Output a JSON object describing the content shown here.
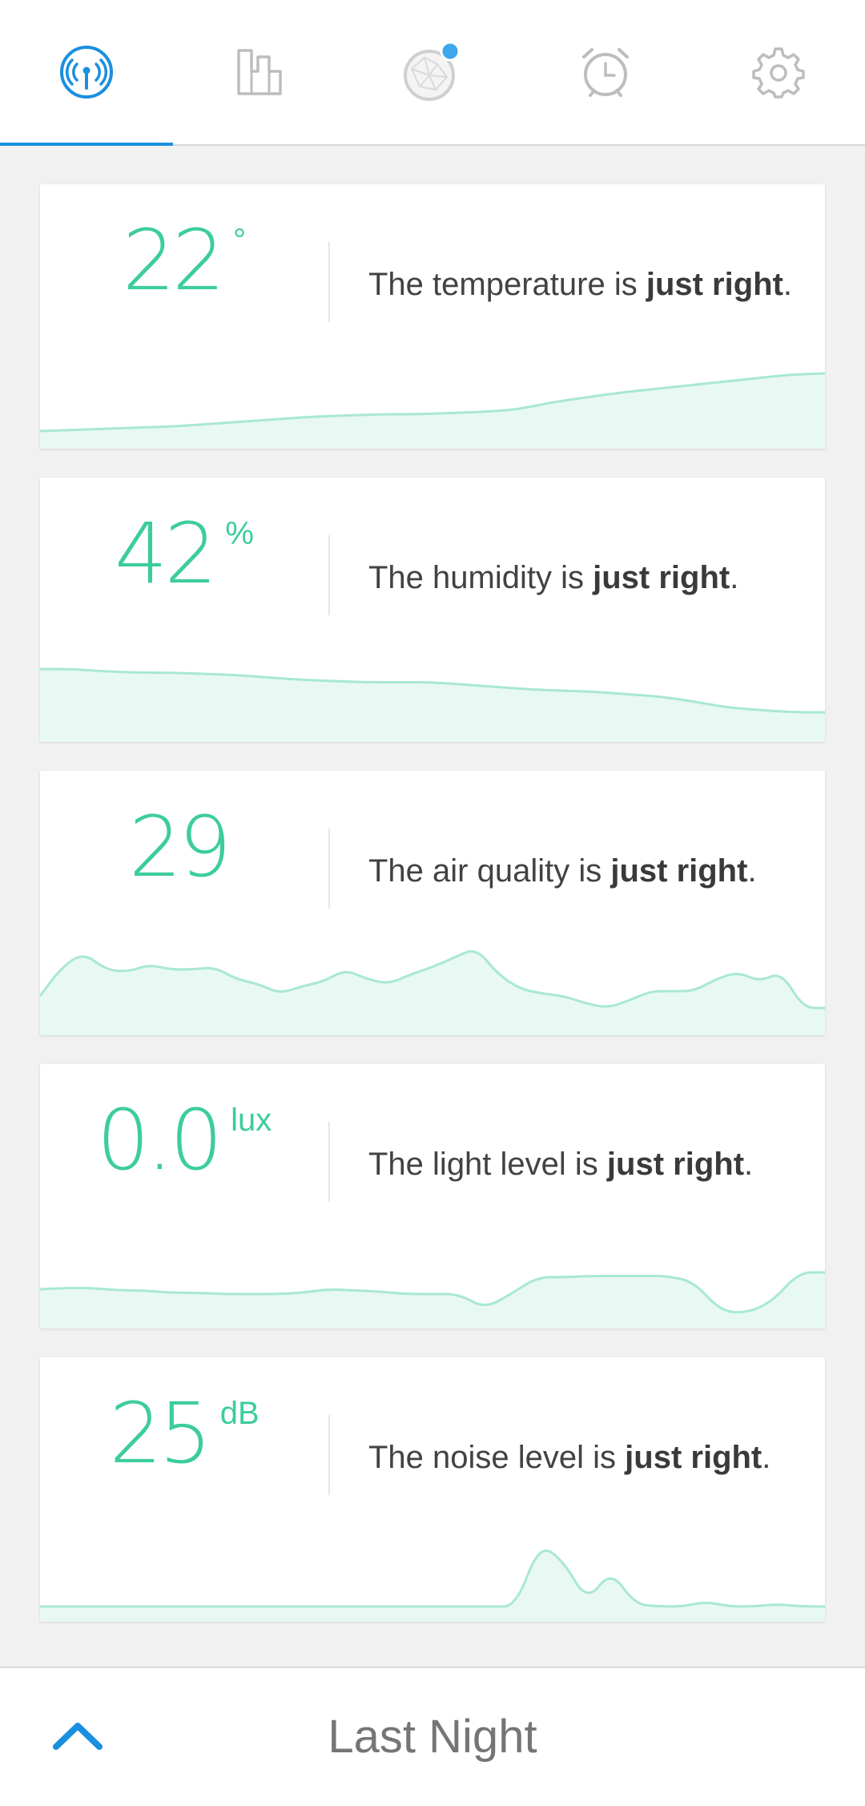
{
  "tabs": [
    {
      "name": "sensors",
      "icon": "broadcast-icon",
      "active": true
    },
    {
      "name": "rooms",
      "icon": "floorplan-icon",
      "active": false
    },
    {
      "name": "device",
      "icon": "sensor-orb-icon",
      "active": false,
      "badge": true
    },
    {
      "name": "alarm",
      "icon": "alarm-clock-icon",
      "active": false
    },
    {
      "name": "settings",
      "icon": "gear-icon",
      "active": false
    }
  ],
  "colors": {
    "accent": "#1a8fe0",
    "reading": "#3dcc9e",
    "chart_line": "#a8e8d2",
    "chart_fill": "#e8f8f2",
    "icon_inactive": "#bdbdbd"
  },
  "cards": [
    {
      "value": "22",
      "unit": "°",
      "text_prefix": "The temperature is ",
      "text_bold": "just right",
      "text_suffix": ".",
      "trend": [
        0.12,
        0.13,
        0.14,
        0.15,
        0.16,
        0.18,
        0.2,
        0.22,
        0.24,
        0.25,
        0.26,
        0.26,
        0.27,
        0.28,
        0.3,
        0.36,
        0.4,
        0.44,
        0.47,
        0.5,
        0.53,
        0.56,
        0.59,
        0.6
      ]
    },
    {
      "value": "42",
      "unit": "%",
      "text_prefix": "The humidity is ",
      "text_bold": "just right",
      "text_suffix": ".",
      "trend": [
        0.58,
        0.58,
        0.56,
        0.55,
        0.55,
        0.54,
        0.53,
        0.51,
        0.49,
        0.48,
        0.47,
        0.47,
        0.47,
        0.45,
        0.43,
        0.41,
        0.4,
        0.39,
        0.37,
        0.35,
        0.31,
        0.26,
        0.24,
        0.22,
        0.22
      ]
    },
    {
      "value": "29",
      "unit": "",
      "text_prefix": "The air quality is ",
      "text_bold": "just right",
      "text_suffix": ".",
      "trend": [
        0.3,
        0.54,
        0.66,
        0.52,
        0.5,
        0.56,
        0.52,
        0.52,
        0.54,
        0.44,
        0.4,
        0.32,
        0.38,
        0.42,
        0.52,
        0.44,
        0.4,
        0.48,
        0.54,
        0.62,
        0.7,
        0.48,
        0.36,
        0.32,
        0.3,
        0.24,
        0.2,
        0.26,
        0.34,
        0.34,
        0.34,
        0.44,
        0.5,
        0.42,
        0.5,
        0.2,
        0.2
      ]
    },
    {
      "value": "0.0",
      "unit": "lux",
      "text_prefix": "The light level is ",
      "text_bold": "just right",
      "text_suffix": ".",
      "trend": [
        0.3,
        0.31,
        0.31,
        0.29,
        0.29,
        0.27,
        0.27,
        0.26,
        0.26,
        0.26,
        0.27,
        0.3,
        0.29,
        0.28,
        0.26,
        0.26,
        0.26,
        0.14,
        0.26,
        0.4,
        0.4,
        0.41,
        0.41,
        0.41,
        0.41,
        0.36,
        0.12,
        0.1,
        0.2,
        0.44,
        0.44
      ]
    },
    {
      "value": "25",
      "unit": "dB",
      "text_prefix": "The noise level is ",
      "text_bold": "just right",
      "text_suffix": ".",
      "trend": [
        0.1,
        0.1,
        0.1,
        0.1,
        0.1,
        0.1,
        0.1,
        0.1,
        0.1,
        0.1,
        0.1,
        0.1,
        0.1,
        0.1,
        0.1,
        0.1,
        0.1,
        0.1,
        0.1,
        0.1,
        0.1,
        0.62,
        0.48,
        0.14,
        0.4,
        0.12,
        0.1,
        0.1,
        0.14,
        0.1,
        0.1,
        0.12,
        0.1,
        0.1
      ]
    }
  ],
  "footer": {
    "period": "Last Night",
    "expand_icon": "chevron-up-icon"
  }
}
